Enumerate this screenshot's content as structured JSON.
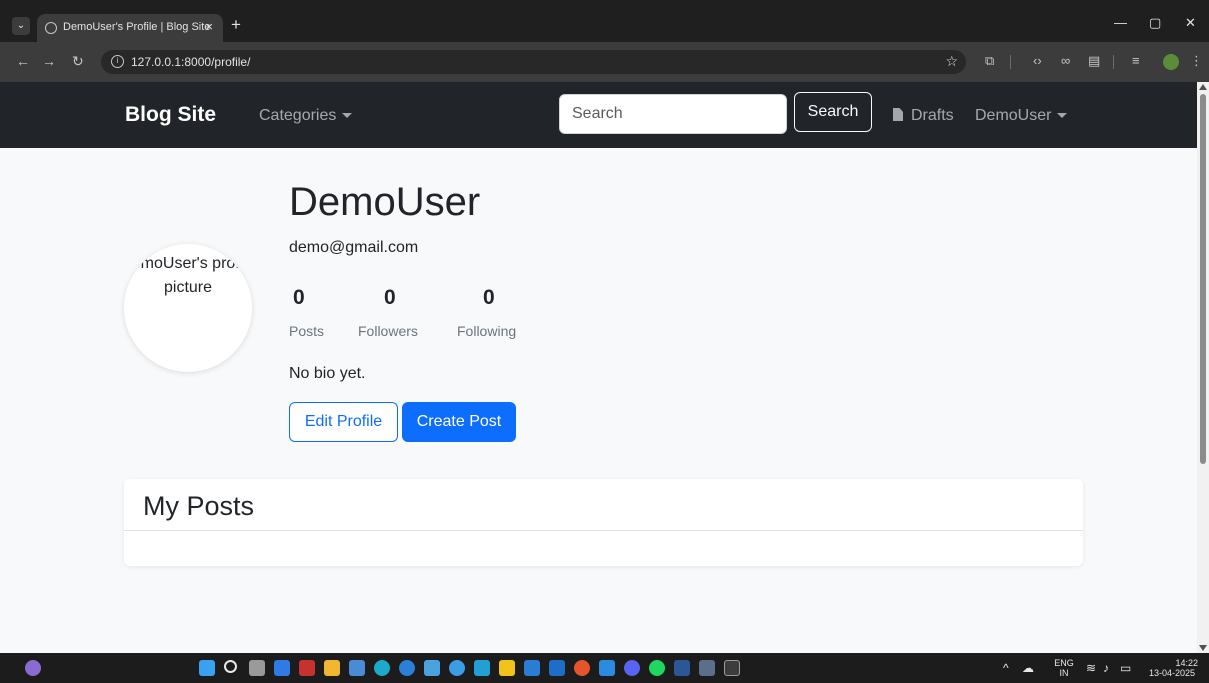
{
  "browser": {
    "tab_title": "DemoUser's Profile | Blog Site",
    "tab_close": "×",
    "new_tab": "+",
    "url": "127.0.0.1:8000/profile/",
    "minimize": "—",
    "restore": "▢",
    "close": "✕"
  },
  "navbar": {
    "brand": "Blog Site",
    "categories_label": "Categories",
    "search_placeholder": "Search",
    "search_button": "Search",
    "drafts_label": "Drafts",
    "user_menu_label": "DemoUser"
  },
  "profile": {
    "avatar_alt": "DemoUser's profile picture",
    "username": "DemoUser",
    "email": "demo@gmail.com",
    "stats": [
      {
        "value": "0",
        "label": "Posts"
      },
      {
        "value": "0",
        "label": "Followers"
      },
      {
        "value": "0",
        "label": "Following"
      }
    ],
    "bio": "No bio yet.",
    "edit_profile_button": "Edit Profile",
    "create_post_button": "Create Post"
  },
  "posts_section": {
    "title": "My Posts"
  },
  "taskbar": {
    "language_top": "ENG",
    "language_bottom": "IN",
    "time": "14:22",
    "date": "13-04-2025"
  },
  "colors": {
    "navbar_bg": "#212529",
    "primary": "#0d6efd",
    "page_bg": "#f8f9fa"
  }
}
